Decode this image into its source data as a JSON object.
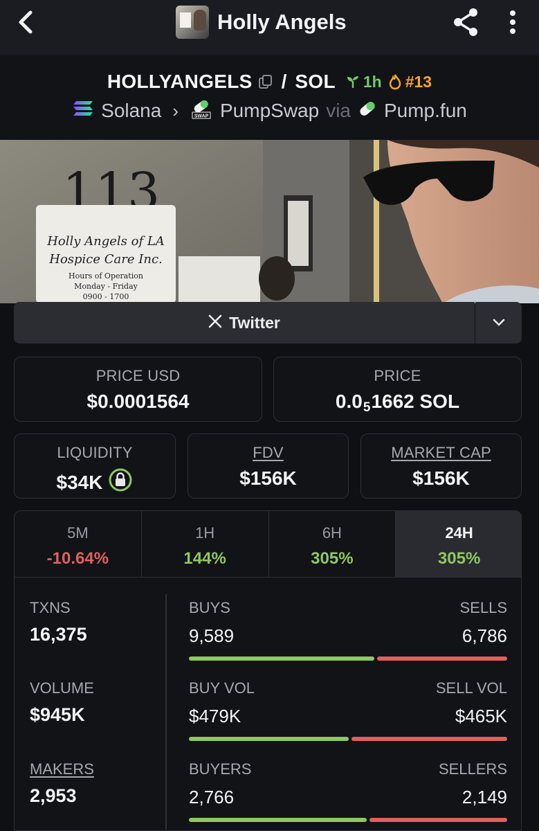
{
  "header": {
    "title": "Holly Angels",
    "avatar_icon": "token-avatar"
  },
  "pair": {
    "token": "HOLLYANGELS",
    "quote": "SOL",
    "separator": "/",
    "age": "1h",
    "rank": "#13",
    "chain": "Solana",
    "dex": "PumpSwap",
    "dex_badge": "SWAP",
    "via_label": "via",
    "launchpad": "Pump.fun"
  },
  "banner": {
    "unit_number": "113",
    "sign_line1": "Holly Angels of LA",
    "sign_line2": "Hospice Care Inc.",
    "sign_line3": "Hours of Operation",
    "sign_line4": "Monday - Friday",
    "sign_line5": "0900 - 1700"
  },
  "social": {
    "twitter_label": "Twitter"
  },
  "stats": {
    "price_usd_label": "PRICE USD",
    "price_usd": "$0.0001564",
    "price_label": "PRICE",
    "price_sol_prefix": "0.0",
    "price_sol_sub": "5",
    "price_sol_suffix": "1662 SOL",
    "liquidity_label": "LIQUIDITY",
    "liquidity": "$34K",
    "fdv_label": "FDV",
    "fdv": "$156K",
    "mcap_label": "MARKET CAP",
    "mcap": "$156K"
  },
  "timeframes": [
    {
      "label": "5M",
      "change": "-10.64%"
    },
    {
      "label": "1H",
      "change": "144%"
    },
    {
      "label": "6H",
      "change": "305%"
    },
    {
      "label": "24H",
      "change": "305%"
    }
  ],
  "activity": {
    "txns_label": "TXNS",
    "txns": "16,375",
    "volume_label": "VOLUME",
    "volume": "$945K",
    "makers_label": "MAKERS",
    "makers": "2,953",
    "buys_label": "BUYS",
    "buys": "9,589",
    "sells_label": "SELLS",
    "sells": "6,786",
    "buy_vol_label": "BUY VOL",
    "buy_vol": "$479K",
    "sell_vol_label": "SELL VOL",
    "sell_vol": "$465K",
    "buyers_label": "BUYERS",
    "buyers": "2,766",
    "sellers_label": "SELLERS",
    "sellers": "2,149",
    "buys_fraction": 0.586,
    "buy_vol_fraction": 0.507,
    "buyers_fraction": 0.563
  },
  "colors": {
    "positive": "#8fc860",
    "negative": "#e0605d",
    "rank": "#f5a623",
    "age": "#74c86a"
  }
}
